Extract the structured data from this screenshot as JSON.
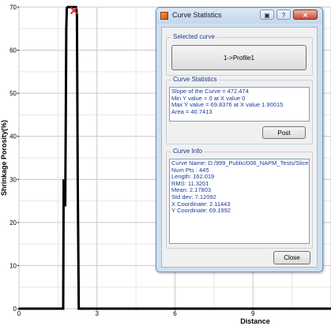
{
  "window": {
    "title": "Curve Statistics",
    "restore_glyph": "▣",
    "help_glyph": "?",
    "close_glyph": "✕"
  },
  "selected_curve": {
    "label": "Selected curve",
    "button_label": "1->Profile1"
  },
  "curve_statistics": {
    "label": "Curve  Statistics",
    "lines": [
      "Slope of the Curve = 472.474",
      "Min Y value = 0 at X value 0",
      "Max Y value = 69.8376 at X value 1.90015",
      "Area = 40.7413"
    ],
    "post_label": "Post"
  },
  "curve_info": {
    "label": "Curve Info",
    "lines": [
      "Curve Name: D:/999_Public/006_NAPM_Tests/Slice",
      "Num Pts : 445",
      "Length: 162.019",
      "RMS: 11.3201",
      "Mean: 2.17803",
      "Std dev: 7.12092",
      "X Coordinate: 2.11443",
      "Y Coordinate: 69.1992"
    ]
  },
  "close_label": "Close",
  "chart_data": {
    "type": "line",
    "xlabel": "Distance",
    "ylabel": "Shrinkage Porosity(%)",
    "y_ticks": [
      "0",
      "10",
      "20",
      "30",
      "40",
      "50",
      "60",
      "70"
    ],
    "x_ticks": [
      "0",
      "3",
      "6",
      "9"
    ],
    "xlim": [
      0,
      12
    ],
    "ylim": [
      0,
      70
    ],
    "grid": true,
    "series": [
      {
        "color": "#000000",
        "x": [
          0,
          1.7,
          1.72,
          1.74,
          1.76,
          1.78,
          1.8,
          1.82,
          1.84,
          1.87,
          1.9,
          2.2,
          2.23,
          2.26,
          2.3,
          2.35,
          12
        ],
        "y": [
          0,
          0,
          30,
          25,
          24,
          24,
          45,
          65,
          69.8,
          70,
          70,
          70,
          68,
          30,
          0,
          0,
          0
        ]
      }
    ],
    "marker": {
      "x": 2.11443,
      "y": 69.1992,
      "symbol": "x",
      "color": "#e03030"
    }
  }
}
